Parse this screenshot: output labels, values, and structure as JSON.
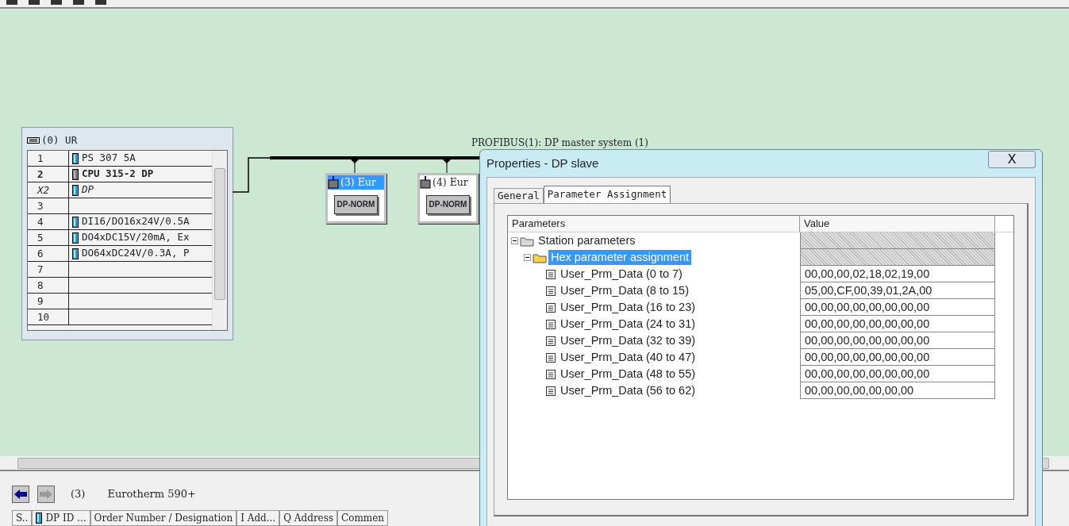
{
  "rack": {
    "title": "(0) UR",
    "rows": [
      {
        "slot": "1",
        "module": "PS 307 5A",
        "kind": "module"
      },
      {
        "slot": "2",
        "module": "CPU 315-2 DP",
        "kind": "cpu"
      },
      {
        "slot": "X2",
        "module": "DP",
        "kind": "interface"
      },
      {
        "slot": "3",
        "kind": "empty"
      },
      {
        "slot": "4",
        "module": "DI16/DO16x24V/0.5A",
        "kind": "module"
      },
      {
        "slot": "5",
        "module": "DO4xDC15V/20mA, Ex",
        "kind": "module"
      },
      {
        "slot": "6",
        "module": "DO64xDC24V/0.3A, P",
        "kind": "module"
      },
      {
        "slot": "7",
        "kind": "empty"
      },
      {
        "slot": "8",
        "kind": "empty"
      },
      {
        "slot": "9",
        "kind": "empty"
      },
      {
        "slot": "10",
        "kind": "empty"
      }
    ]
  },
  "bus": {
    "label": "PROFIBUS(1): DP master system (1)"
  },
  "slaves": [
    {
      "title": "(3) Eur",
      "badge": "DP-NORM",
      "selected": true
    },
    {
      "title": "(4) Eur",
      "badge": "DP-NORM",
      "selected": false
    }
  ],
  "detail": {
    "number": "(3)",
    "name": "Eurotherm 590+",
    "columns": [
      "S..",
      "DP ID ...",
      "Order Number / Designation",
      "I Add...",
      "Q Address",
      "Commen"
    ]
  },
  "dialog": {
    "title": "Properties - DP slave",
    "close": "X",
    "tabs": [
      {
        "label": "General",
        "selected": false
      },
      {
        "label": "Parameter Assignment",
        "selected": true
      }
    ],
    "columns": [
      "Parameters",
      "Value"
    ],
    "tree": [
      {
        "label": "Station parameters",
        "expanded": true,
        "selected": false,
        "children": [
          {
            "label": "Hex parameter assignment",
            "expanded": true,
            "selected": true,
            "children": [
              {
                "label": "User_Prm_Data (0 to 7)",
                "value": "00,00,00,02,18,02,19,00",
                "selected": false
              },
              {
                "label": "User_Prm_Data (8 to 15)",
                "value": "05,00,CF,00,39,01,2A,00",
                "selected": false
              },
              {
                "label": "User_Prm_Data (16 to 23)",
                "value": "00,00,00,00,00,00,00,00",
                "selected": false
              },
              {
                "label": "User_Prm_Data (24 to 31)",
                "value": "00,00,00,00,00,00,00,00",
                "selected": false
              },
              {
                "label": "User_Prm_Data (32 to 39)",
                "value": "00,00,00,00,00,00,00,00",
                "selected": false
              },
              {
                "label": "User_Prm_Data (40 to 47)",
                "value": "00,00,00,00,00,00,00,00",
                "selected": false
              },
              {
                "label": "User_Prm_Data (48 to 55)",
                "value": "00,00,00,00,00,00,00,00",
                "selected": false
              },
              {
                "label": "User_Prm_Data (56 to 62)",
                "value": "00,00,00,00,00,00,00",
                "selected": false
              }
            ]
          }
        ]
      }
    ]
  }
}
